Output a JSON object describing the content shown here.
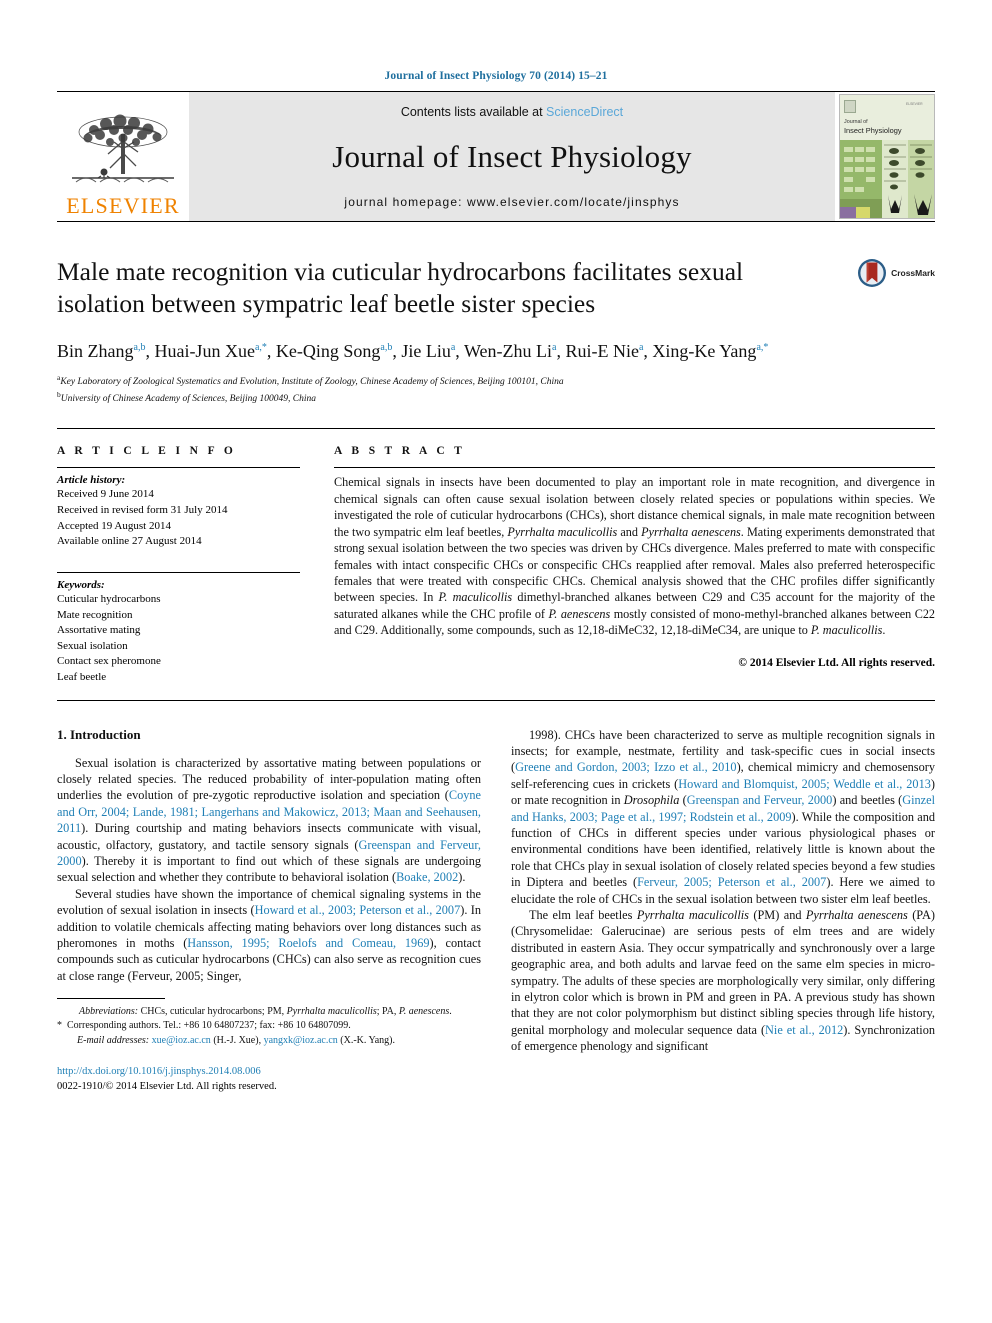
{
  "running_head": "Journal of Insect Physiology 70 (2014) 15–21",
  "masthead": {
    "publisher": "ELSEVIER",
    "contents_prefix": "Contents lists available at ",
    "contents_link": "ScienceDirect",
    "journal_title": "Journal of Insect Physiology",
    "homepage": "journal homepage: www.elsevier.com/locate/jinsphys",
    "cover_line1": "Journal of",
    "cover_line2": "Insect Physiology"
  },
  "article": {
    "title": "Male mate recognition via cuticular hydrocarbons facilitates sexual isolation between sympatric leaf beetle sister species",
    "crossmark_label": "CrossMark",
    "authors": [
      {
        "name": "Bin Zhang",
        "sup": "a,b"
      },
      {
        "name": "Huai-Jun Xue",
        "sup": "a,*"
      },
      {
        "name": "Ke-Qing Song",
        "sup": "a,b"
      },
      {
        "name": "Jie Liu",
        "sup": "a"
      },
      {
        "name": "Wen-Zhu Li",
        "sup": "a"
      },
      {
        "name": "Rui-E Nie",
        "sup": "a"
      },
      {
        "name": "Xing-Ke Yang",
        "sup": "a,*"
      }
    ],
    "affiliations": [
      {
        "marker": "a",
        "text": "Key Laboratory of Zoological Systematics and Evolution, Institute of Zoology, Chinese Academy of Sciences, Beijing 100101, China"
      },
      {
        "marker": "b",
        "text": "University of Chinese Academy of Sciences, Beijing 100049, China"
      }
    ]
  },
  "article_info": {
    "heading": "A R T I C L E   I N F O",
    "history_label": "Article history:",
    "history": [
      "Received 9 June 2014",
      "Received in revised form 31 July 2014",
      "Accepted 19 August 2014",
      "Available online 27 August 2014"
    ],
    "keywords_label": "Keywords:",
    "keywords": [
      "Cuticular hydrocarbons",
      "Mate recognition",
      "Assortative mating",
      "Sexual isolation",
      "Contact sex pheromone",
      "Leaf beetle"
    ]
  },
  "abstract": {
    "heading": "A B S T R A C T",
    "text": "Chemical signals in insects have been documented to play an important role in mate recognition, and divergence in chemical signals can often cause sexual isolation between closely related species or populations within species. We investigated the role of cuticular hydrocarbons (CHCs), short distance chemical signals, in male mate recognition between the two sympatric elm leaf beetles, Pyrrhalta maculicollis and Pyrrhalta aenescens. Mating experiments demonstrated that strong sexual isolation between the two species was driven by CHCs divergence. Males preferred to mate with conspecific females with intact conspecific CHCs or conspecific CHCs reapplied after removal. Males also preferred heterospecific females that were treated with conspecific CHCs. Chemical analysis showed that the CHC profiles differ significantly between species. In P. maculicollis dimethyl-branched alkanes between C29 and C35 account for the majority of the saturated alkanes while the CHC profile of P. aenescens mostly consisted of mono-methyl-branched alkanes between C22 and C29. Additionally, some compounds, such as 12,18-diMeC32, 12,18-diMeC34, are unique to P. maculicollis.",
    "copyright": "© 2014 Elsevier Ltd. All rights reserved."
  },
  "introduction": {
    "section_number_title": "1. Introduction",
    "left_paragraphs": [
      "Sexual isolation is characterized by assortative mating between populations or closely related species. The reduced probability of inter-population mating often underlies the evolution of pre-zygotic reproductive isolation and speciation (Coyne and Orr, 2004; Lande, 1981; Langerhans and Makowicz, 2013; Maan and Seehausen, 2011). During courtship and mating behaviors insects communicate with visual, acoustic, olfactory, gustatory, and tactile sensory signals (Greenspan and Ferveur, 2000). Thereby it is important to find out which of these signals are undergoing sexual selection and whether they contribute to behavioral isolation (Boake, 2002).",
      "Several studies have shown the importance of chemical signaling systems in the evolution of sexual isolation in insects (Howard et al., 2003; Peterson et al., 2007). In addition to volatile chemicals affecting mating behaviors over long distances such as pheromones in moths (Hansson, 1995; Roelofs and Comeau, 1969), contact compounds such as cuticular hydrocarbons (CHCs) can also serve as recognition cues at close range (Ferveur, 2005; Singer,"
    ],
    "right_paragraphs": [
      "1998). CHCs have been characterized to serve as multiple recognition signals in insects; for example, nestmate, fertility and task-specific cues in social insects (Greene and Gordon, 2003; Izzo et al., 2010), chemical mimicry and chemosensory self-referencing cues in crickets (Howard and Blomquist, 2005; Weddle et al., 2013) or mate recognition in Drosophila (Greenspan and Ferveur, 2000) and beetles (Ginzel and Hanks, 2003; Page et al., 1997; Rodstein et al., 2009). While the composition and function of CHCs in different species under various physiological phases or environmental conditions have been identified, relatively little is known about the role that CHCs play in sexual isolation of closely related species beyond a few studies in Diptera and beetles (Ferveur, 2005; Peterson et al., 2007). Here we aimed to elucidate the role of CHCs in the sexual isolation between two sister elm leaf beetles.",
      "The elm leaf beetles Pyrrhalta maculicollis (PM) and Pyrrhalta aenescens (PA) (Chrysomelidae: Galerucinae) are serious pests of elm trees and are widely distributed in eastern Asia. They occur sympatrically and synchronously over a large geographic area, and both adults and larvae feed on the same elm species in micro-sympatry. The adults of these species are morphologically very similar, only differing in elytron color which is brown in PM and green in PA. A previous study has shown that they are not color polymorphism but distinct sibling species through life history, genital morphology and molecular sequence data (Nie et al., 2012). Synchronization of emergence phenology and significant"
    ]
  },
  "footnotes": {
    "abbreviations_label": "Abbreviations:",
    "abbreviations_text": "CHCs, cuticular hydrocarbons; PM, Pyrrhalta maculicollis; PA, P. aenescens.",
    "corresponding": "Corresponding authors. Tel.: +86 10 64807237; fax: +86 10 64807099.",
    "email_label": "E-mail addresses:",
    "email_1": "xue@ioz.ac.cn",
    "email_1_who": "(H.-J. Xue),",
    "email_2": "yangxk@ioz.ac.cn",
    "email_2_who": "(X.-K. Yang).",
    "doi": "http://dx.doi.org/10.1016/j.jinsphys.2014.08.006",
    "issn_line": "0022-1910/© 2014 Elsevier Ltd. All rights reserved."
  },
  "colors": {
    "link_blue": "#1f7fb5",
    "elsevier_orange": "#ef8200",
    "band_gray": "#e6e6e6",
    "sciencedirect_blue": "#5aa7d8"
  }
}
